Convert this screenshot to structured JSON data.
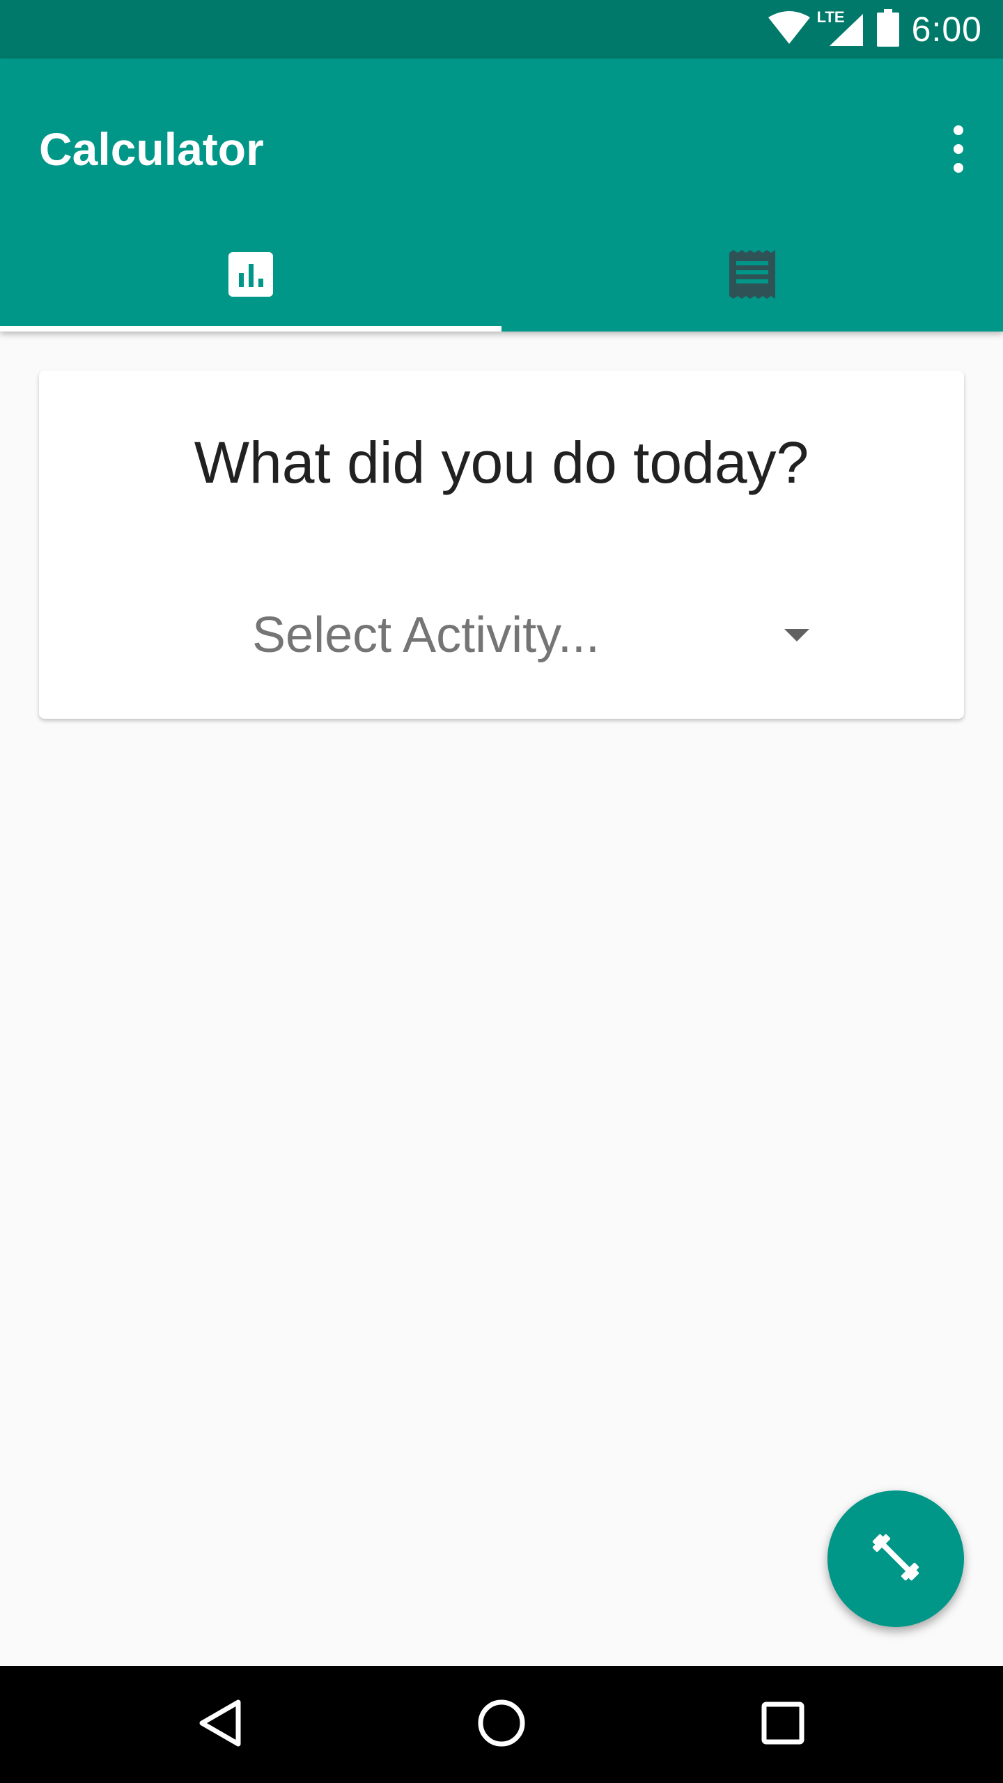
{
  "status_bar": {
    "time": "6:00",
    "network_label": "LTE",
    "icons": [
      "wifi-icon",
      "cell-signal-icon",
      "battery-icon"
    ]
  },
  "app_bar": {
    "title": "Calculator",
    "menu_icon": "more-vert-icon",
    "background_color": "#009688"
  },
  "tabs": [
    {
      "icon": "bar-chart-icon",
      "selected": true
    },
    {
      "icon": "receipt-icon",
      "selected": false
    }
  ],
  "card": {
    "question": "What did you do today?",
    "select": {
      "value": "Select Activity...",
      "icon": "dropdown-arrow-icon"
    }
  },
  "fab": {
    "icon": "dumbbell-icon",
    "color": "#009688"
  },
  "nav_bar": {
    "buttons": [
      "back-icon",
      "home-icon",
      "recents-icon"
    ]
  }
}
